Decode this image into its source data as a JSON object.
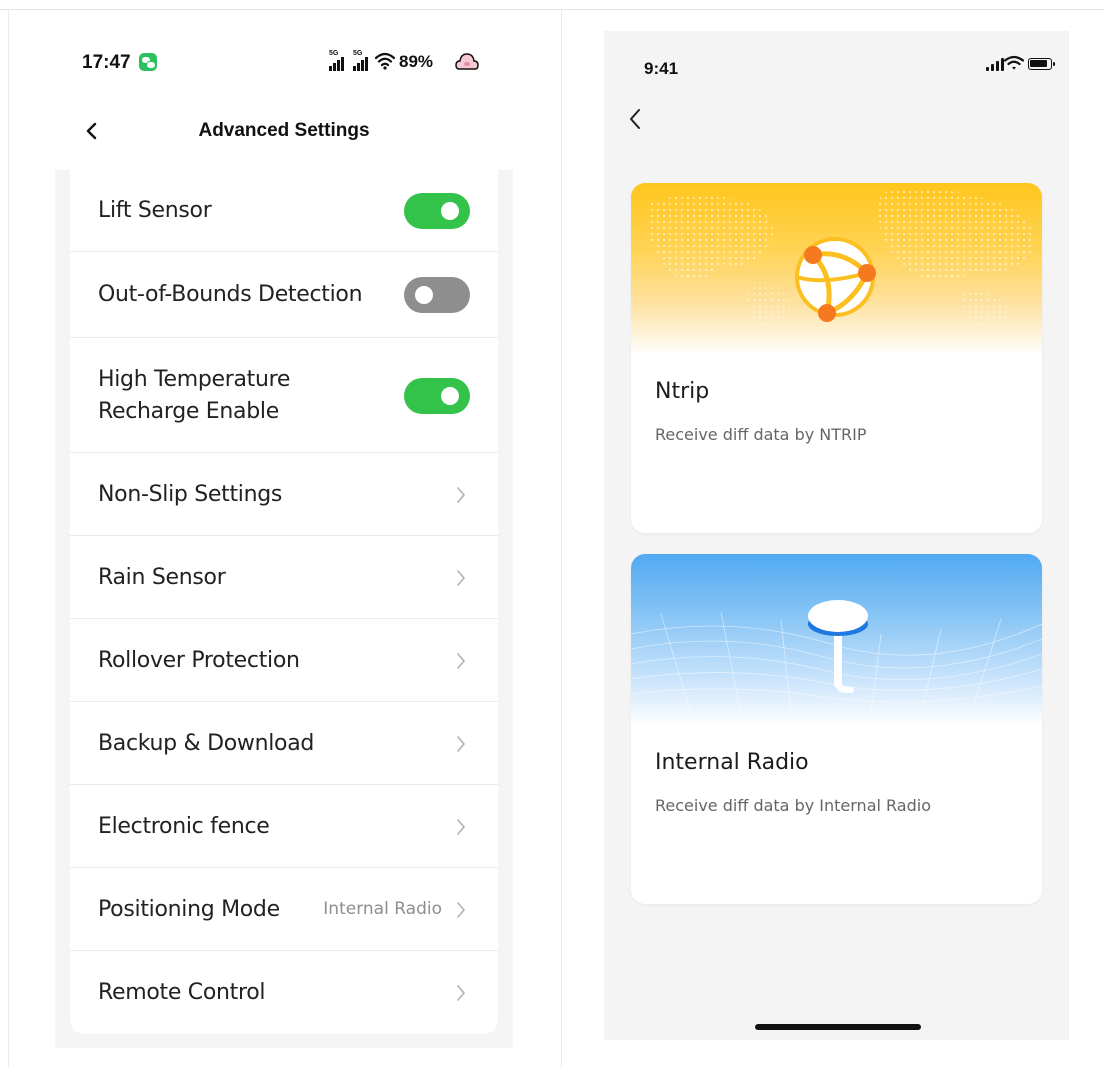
{
  "left_phone": {
    "status_bar": {
      "time": "17:47",
      "network_1": "5G",
      "network_2": "5G",
      "battery": "89%",
      "icons": [
        "wechat-icon",
        "signal-icon",
        "signal-icon",
        "wifi-icon",
        "cloud-pig-icon"
      ]
    },
    "nav": {
      "back_icon": "chevron-left-icon",
      "title": "Advanced Settings"
    },
    "settings": [
      {
        "label": "Lift Sensor",
        "control": "toggle",
        "on": true
      },
      {
        "label": "Out-of-Bounds Detection",
        "control": "toggle",
        "on": false
      },
      {
        "label": "High Temperature\nRecharge Enable",
        "control": "toggle",
        "on": true
      },
      {
        "label": "Non-Slip Settings",
        "control": "chevron"
      },
      {
        "label": "Rain Sensor",
        "control": "chevron"
      },
      {
        "label": "Rollover Protection",
        "control": "chevron"
      },
      {
        "label": "Backup & Download",
        "control": "chevron"
      },
      {
        "label": "Electronic fence",
        "control": "chevron"
      },
      {
        "label": "Positioning Mode",
        "control": "chevron",
        "value": "Internal Radio"
      },
      {
        "label": "Remote Control",
        "control": "chevron"
      }
    ],
    "colors": {
      "toggle_on": "#34c34a",
      "toggle_off": "#8e8e8e"
    }
  },
  "right_phone": {
    "status_bar": {
      "time": "9:41",
      "icons": [
        "signal-icon",
        "wifi-icon",
        "battery-icon"
      ]
    },
    "nav": {
      "back_icon": "chevron-left-icon"
    },
    "cards": [
      {
        "title": "Ntrip",
        "description": "Receive diff data by NTRIP",
        "illustration": "globe-network-icon"
      },
      {
        "title": "Internal Radio",
        "description": "Receive diff data by Internal Radio",
        "illustration": "radio-antenna-icon"
      }
    ],
    "colors": {
      "ntrip_accent": "#ffc61c",
      "radio_accent": "#51aaf2"
    }
  }
}
